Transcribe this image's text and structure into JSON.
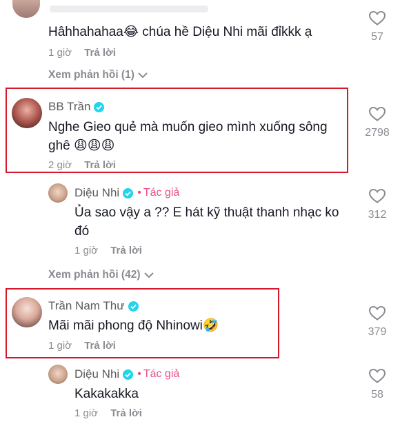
{
  "comments": [
    {
      "text": "Hâhhahahaa😂 chúa hề Diệu Nhi mãi đỉkkk ạ",
      "time": "1 giờ",
      "reply_label": "Trả lời",
      "likes": "57"
    },
    {
      "view_replies_label": "Xem phản hồi (1)"
    },
    {
      "author": "BB Trần",
      "text_line1": "Nghe Gieo quẻ mà muốn gieo mình xuống sông",
      "text_line2": "ghê 😩😩😩",
      "time": "2 giờ",
      "reply_label": "Trả lời",
      "likes": "2798"
    },
    {
      "author": "Diệu Nhi",
      "author_dot": "•",
      "author_tag": "Tác giả",
      "text_line1": "Ủa sao vậy a ?? E hát kỹ thuật thanh nhạc ko",
      "text_line2": "đó",
      "time": "1 giờ",
      "reply_label": "Trả lời",
      "likes": "312"
    },
    {
      "view_replies_label": "Xem phản hồi (42)"
    },
    {
      "author": "Trần Nam Thư",
      "text": "Mãi mãi phong độ Nhinowi🤣",
      "time": "1 giờ",
      "reply_label": "Trả lời",
      "likes": "379"
    },
    {
      "author": "Diệu Nhi",
      "author_dot": "•",
      "author_tag": "Tác giả",
      "text": "Kakakakka",
      "time": "1 giờ",
      "reply_label": "Trả lời",
      "likes": "58"
    }
  ],
  "colors": {
    "highlight": "#d6182c",
    "author_tag": "#ea4c89",
    "verified": "#20d5ec",
    "muted": "#8a8b91"
  }
}
